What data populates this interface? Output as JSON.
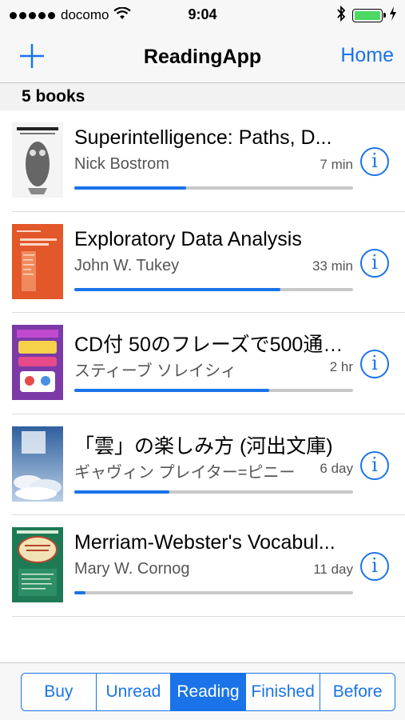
{
  "status_bar": {
    "carrier": "docomo",
    "time": "9:04",
    "signal_bars": 5,
    "battery_level": 1.0,
    "icons": [
      "wifi-icon",
      "bluetooth-icon",
      "battery-icon",
      "charging-icon"
    ]
  },
  "nav": {
    "title": "ReadingApp",
    "left_icon": "plus-icon",
    "right_label": "Home"
  },
  "section": {
    "header": "5 books"
  },
  "books": [
    {
      "title": "Superintelligence: Paths, D...",
      "author": "Nick Bostrom",
      "time": "7 min",
      "progress": 0.4,
      "cover_colors": [
        "#f2f2f2",
        "#555555"
      ]
    },
    {
      "title": "Exploratory Data Analysis",
      "author": "John W. Tukey",
      "time": "33 min",
      "progress": 0.74,
      "cover_colors": [
        "#e2582b",
        "#f07a4a"
      ]
    },
    {
      "title": "CD付 50のフレーズで500通…",
      "author": "スティーブ ソレイシィ",
      "time": "2 hr",
      "progress": 0.7,
      "cover_colors": [
        "#7b3aa8",
        "#f5d24a"
      ]
    },
    {
      "title": "「雲」の楽しみ方 (河出文庫)",
      "author": "ギャヴィン プレイター=ピニー",
      "time": "6 day",
      "progress": 0.34,
      "cover_colors": [
        "#2f5f9e",
        "#cfe0f2"
      ]
    },
    {
      "title": "Merriam-Webster's Vocabul...",
      "author": "Mary W. Cornog",
      "time": "11 day",
      "progress": 0.04,
      "cover_colors": [
        "#1e7a55",
        "#f1e3b5"
      ]
    }
  ],
  "tabs": [
    {
      "label": "Buy",
      "active": false
    },
    {
      "label": "Unread",
      "active": false
    },
    {
      "label": "Reading",
      "active": true
    },
    {
      "label": "Finished",
      "active": false
    },
    {
      "label": "Before",
      "active": false
    }
  ],
  "colors": {
    "accent": "#1a73e8",
    "progress_track": "#c8c8c8",
    "battery": "#4cd964"
  }
}
